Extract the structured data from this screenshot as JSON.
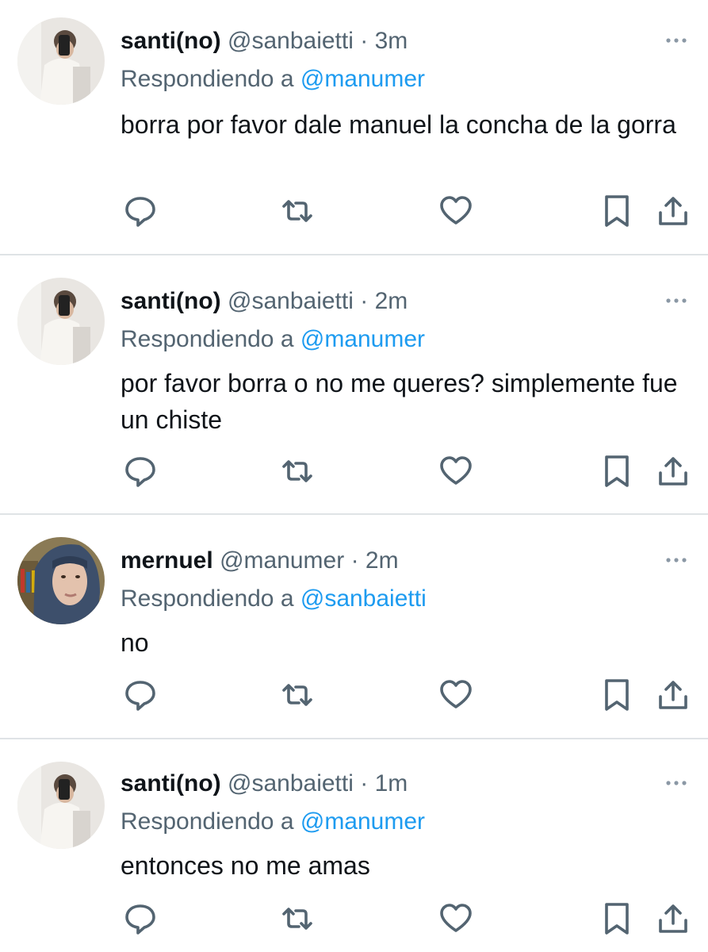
{
  "tweets": [
    {
      "name": "santi(no)",
      "handle": "@sanbaietti",
      "separator": "·",
      "time": "3m",
      "replying_prefix": "Respondiendo a",
      "replying_to": "@manumer",
      "text": "borra por favor dale manuel la concha de la gorra",
      "avatar": "avatar-white-shirt-selfie"
    },
    {
      "name": "santi(no)",
      "handle": "@sanbaietti",
      "separator": "·",
      "time": "2m",
      "replying_prefix": "Respondiendo a",
      "replying_to": "@manumer",
      "text": "por favor borra o no me queres? simplemente fue un chiste",
      "avatar": "avatar-white-shirt-selfie"
    },
    {
      "name": "mernuel",
      "handle": "@manumer",
      "separator": "·",
      "time": "2m",
      "replying_prefix": "Respondiendo a",
      "replying_to": "@sanbaietti",
      "text": "no",
      "avatar": "avatar-hoodie"
    },
    {
      "name": "santi(no)",
      "handle": "@sanbaietti",
      "separator": "·",
      "time": "1m",
      "replying_prefix": "Respondiendo a",
      "replying_to": "@manumer",
      "text": "entonces no me amas",
      "avatar": "avatar-white-shirt-selfie"
    }
  ],
  "icons": {
    "reply": "reply-icon",
    "retweet": "retweet-icon",
    "like": "like-icon",
    "bookmark": "bookmark-icon",
    "share": "share-icon",
    "more": "more-icon"
  },
  "colors": {
    "text_primary": "#0f1419",
    "text_secondary": "#536471",
    "link": "#1d9bf0",
    "divider": "#dfe3e6"
  }
}
